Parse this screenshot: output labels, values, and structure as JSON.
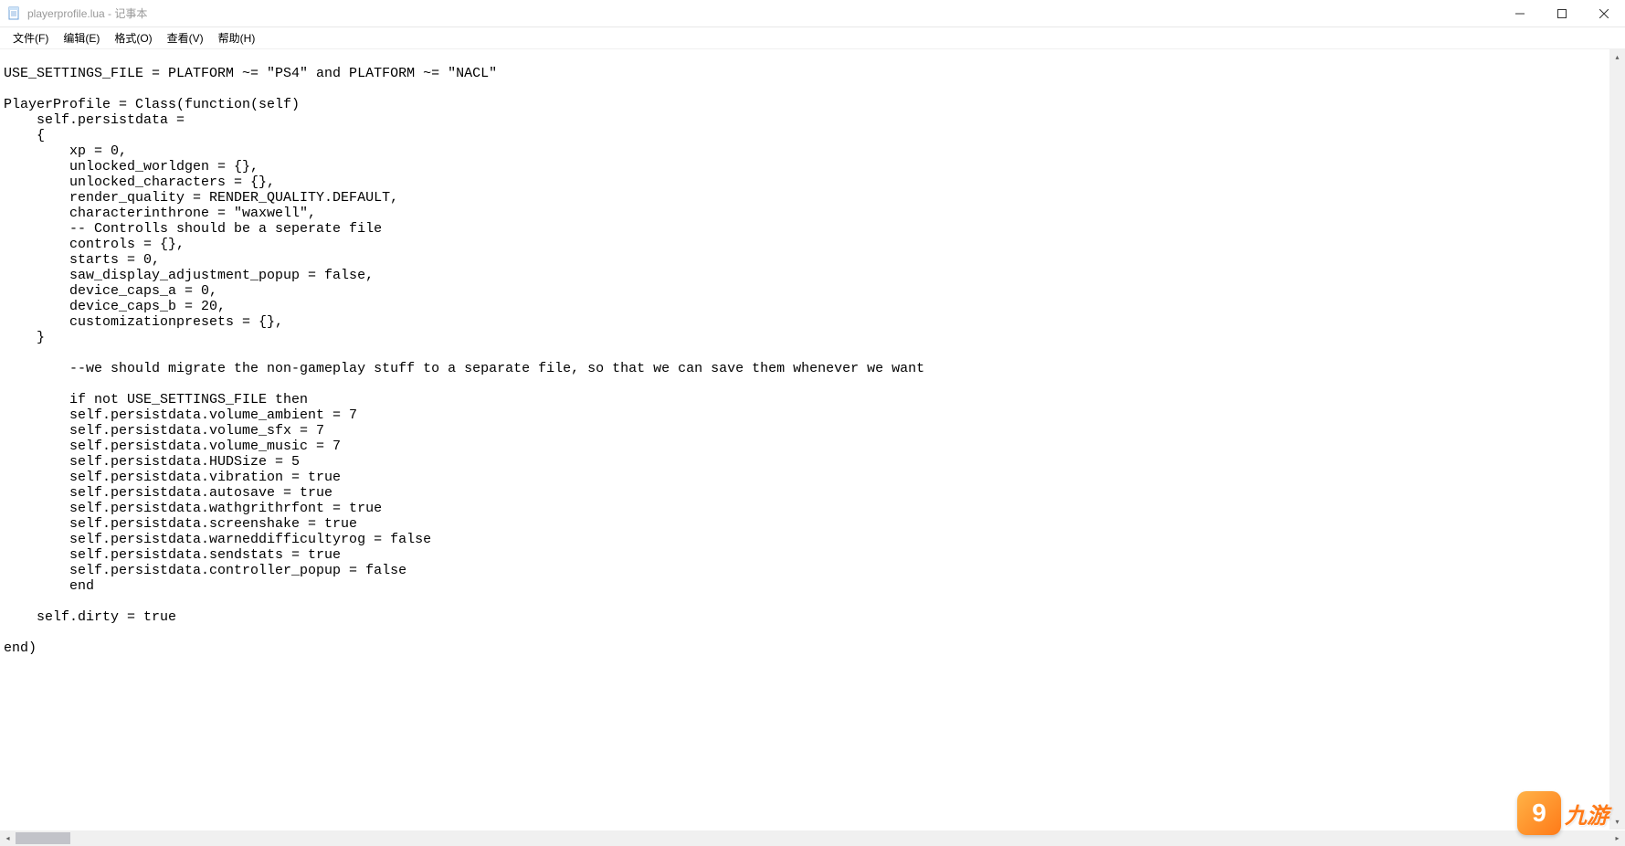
{
  "window": {
    "title": "playerprofile.lua - 记事本"
  },
  "menu": {
    "file": "文件(F)",
    "edit": "编辑(E)",
    "format": "格式(O)",
    "view": "查看(V)",
    "help": "帮助(H)"
  },
  "editor": {
    "content": "USE_SETTINGS_FILE = PLATFORM ~= \"PS4\" and PLATFORM ~= \"NACL\"\n\nPlayerProfile = Class(function(self)\n    self.persistdata =\n    {\n        xp = 0,\n        unlocked_worldgen = {},\n        unlocked_characters = {},\n        render_quality = RENDER_QUALITY.DEFAULT,\n        characterinthrone = \"waxwell\",\n        -- Controlls should be a seperate file\n        controls = {},\n        starts = 0,\n        saw_display_adjustment_popup = false,\n        device_caps_a = 0,\n        device_caps_b = 20,\n        customizationpresets = {},\n    }\n\n        --we should migrate the non-gameplay stuff to a separate file, so that we can save them whenever we want\n\n        if not USE_SETTINGS_FILE then\n        self.persistdata.volume_ambient = 7\n        self.persistdata.volume_sfx = 7\n        self.persistdata.volume_music = 7\n        self.persistdata.HUDSize = 5\n        self.persistdata.vibration = true\n        self.persistdata.autosave = true\n        self.persistdata.wathgrithrfont = true\n        self.persistdata.screenshake = true\n        self.persistdata.warneddifficultyrog = false\n        self.persistdata.sendstats = true\n        self.persistdata.controller_popup = false\n        end\n\n    self.dirty = true\n\nend)"
  },
  "watermark": {
    "logo_char": "9",
    "text": "九游"
  }
}
